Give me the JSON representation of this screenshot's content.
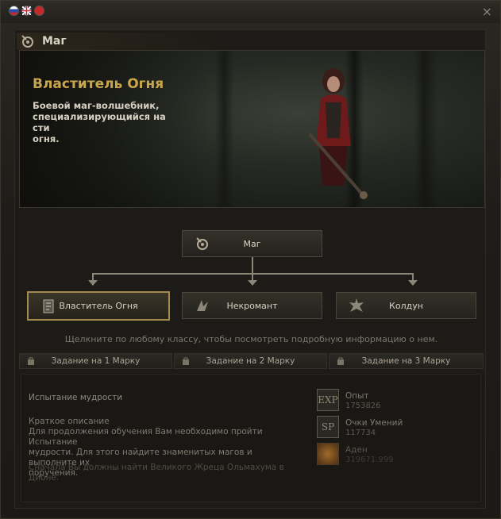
{
  "window": {
    "close_label": "×"
  },
  "header": {
    "class_name": "Маг"
  },
  "banner": {
    "title": "Властитель Огня",
    "description": "Боевой маг-волшебник,\nспециализирующийся на сти\nогня."
  },
  "tree": {
    "root": "Маг",
    "children": [
      "Властитель Огня",
      "Некромант",
      "Колдун"
    ]
  },
  "hint": "Щелкните по любому классу, чтобы посмотреть подробную информацию о нем.",
  "tabs": [
    "Задание на 1 Марку",
    "Задание на 2 Марку",
    "Задание на 3 Марку"
  ],
  "quest": {
    "name": "Испытание мудрости",
    "brief_heading": "Краткое описание",
    "brief_text": "Для продолжения обучения Вам необходимо пройти Испытание\nмудрости. Для этого найдите знаменитых магов и выполните их\nпоручения.",
    "extra_text": "Сначала Вы должны найти Великого Жреца Ольмахума в Дионе."
  },
  "rewards": [
    {
      "icon": "EXP",
      "label": "Опыт",
      "value": "1753826"
    },
    {
      "icon": "SP",
      "label": "Очки Умений",
      "value": "117734"
    },
    {
      "icon": "adena-icon",
      "label": "Аден",
      "value": "319671.999"
    }
  ],
  "colors": {
    "accent_gold": "#c9a64a",
    "selected_border": "#a48a4c"
  }
}
